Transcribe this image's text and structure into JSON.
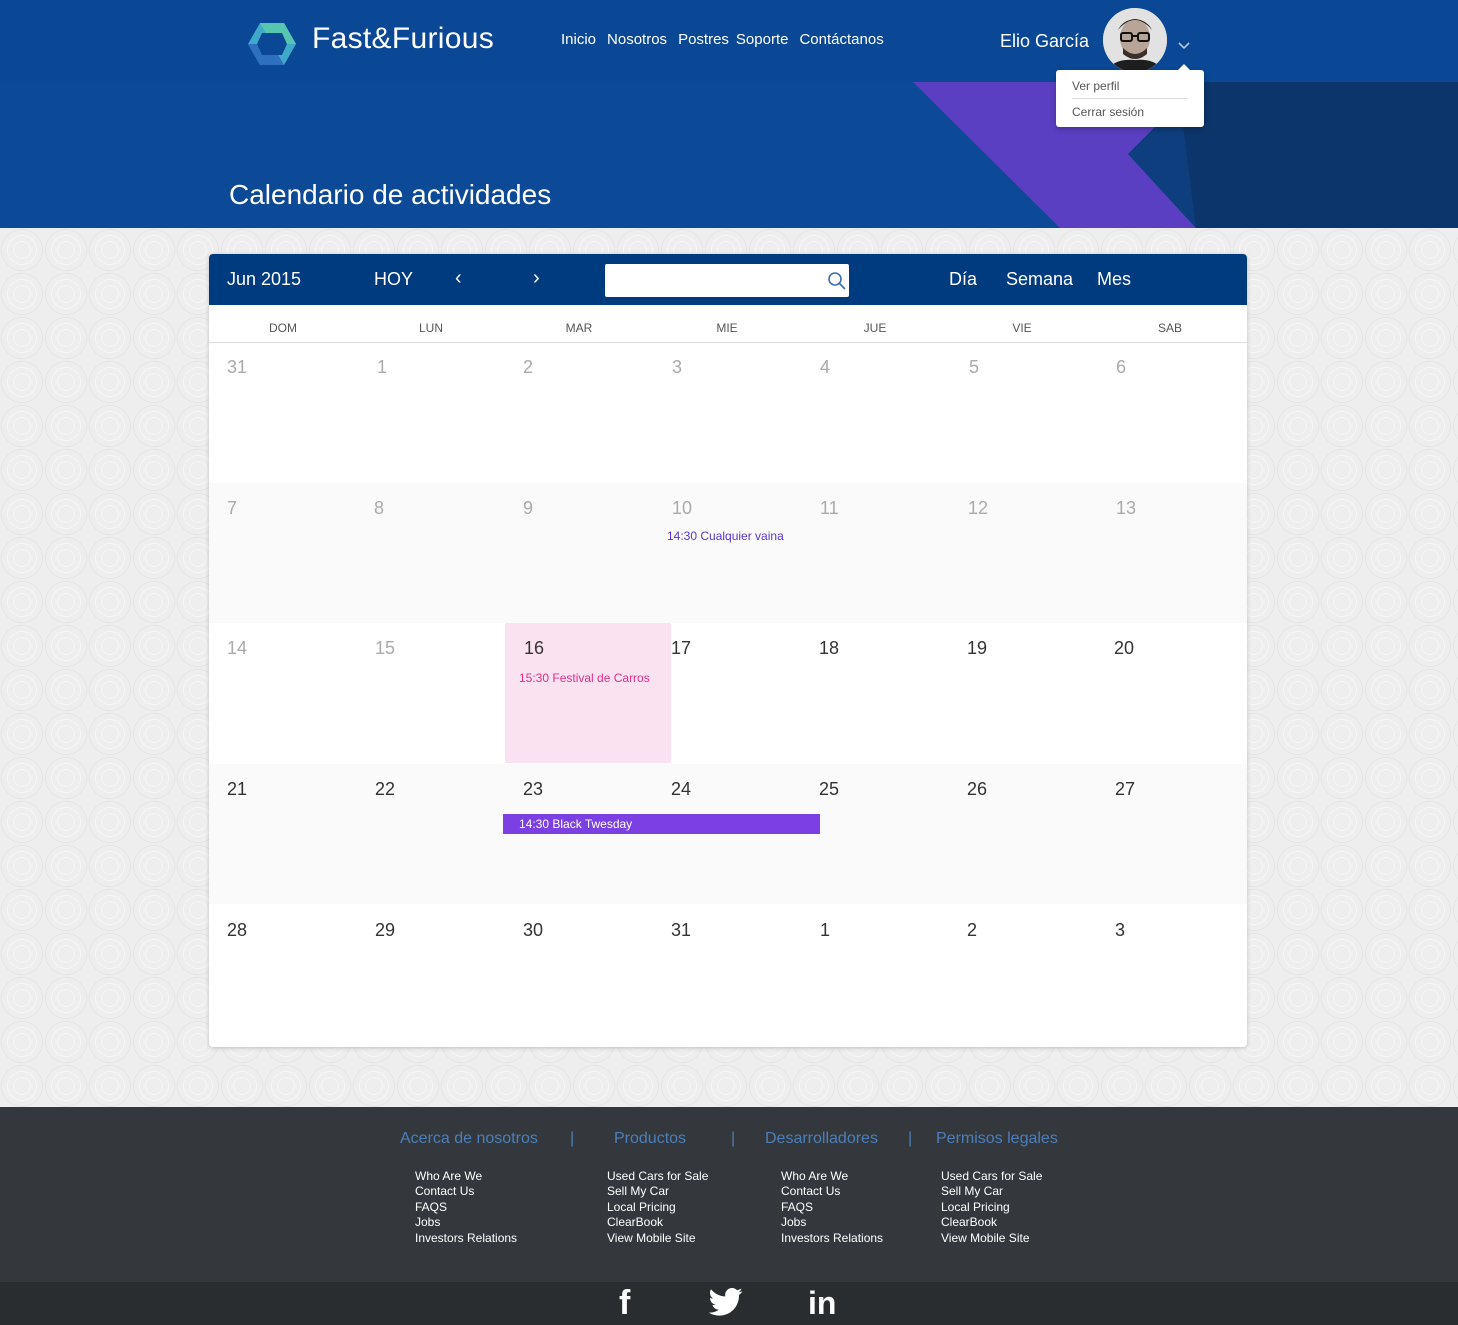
{
  "header": {
    "brand": "Fast&Furious",
    "nav": [
      "Inicio",
      "Nosotros",
      "Postres",
      "Soporte",
      "Contáctanos"
    ],
    "user_name": "Elio García",
    "dropdown": [
      "Ver perfil",
      "Cerrar sesión"
    ]
  },
  "banner": {
    "title": "Calendario de actividades"
  },
  "calendar": {
    "month_label": "Jun 2015",
    "today_label": "HOY",
    "prev_label": "‹",
    "next_label": "›",
    "search_placeholder": "",
    "views": [
      "Día",
      "Semana",
      "Mes"
    ],
    "weekdays": [
      "DOM",
      "LUN",
      "MAR",
      "MIE",
      "JUE",
      "VIE",
      "SAB"
    ],
    "weeks": [
      [
        "31",
        "1",
        "2",
        "3",
        "4",
        "5",
        "6"
      ],
      [
        "7",
        "8",
        "9",
        "10",
        "11",
        "12",
        "13"
      ],
      [
        "14",
        "15",
        "16",
        "17",
        "18",
        "19",
        "20"
      ],
      [
        "21",
        "22",
        "23",
        "24",
        "25",
        "26",
        "27"
      ],
      [
        "28",
        "29",
        "30",
        "31",
        "1",
        "2",
        "3"
      ]
    ],
    "events": [
      {
        "day": "10",
        "label": "14:30 Cualquier vaina",
        "color": "#5a34d4"
      },
      {
        "day": "16",
        "label": "15:30 Festival de Carros",
        "color": "#e0308a"
      },
      {
        "day": "23-24",
        "label": "14:30 Black Twesday",
        "color": "#7c3fe4"
      }
    ],
    "today_highlight_color": "#fbe2f0"
  },
  "footer": {
    "categories": [
      "Acerca de nosotros",
      "Productos",
      "Desarrolladores",
      "Permisos legales"
    ],
    "separator": "|",
    "columns": [
      [
        "Who Are We",
        "Contact Us",
        "FAQS",
        "Jobs",
        "Investors Relations"
      ],
      [
        "Used Cars for Sale",
        "Sell My Car",
        "Local Pricing",
        "ClearBook",
        "View Mobile Site"
      ],
      [
        "Who Are We",
        "Contact Us",
        "FAQS",
        "Jobs",
        "Investors Relations"
      ],
      [
        "Used Cars for Sale",
        "Sell My Car",
        "Local Pricing",
        "ClearBook",
        "View Mobile Site"
      ]
    ]
  },
  "social": {
    "facebook": "f",
    "linkedin": "in"
  },
  "colors": {
    "header_blue": "#0a4896",
    "calendar_header": "#003a7f",
    "accent_purple": "#7c3fe4",
    "footer_dark": "#34383c"
  }
}
